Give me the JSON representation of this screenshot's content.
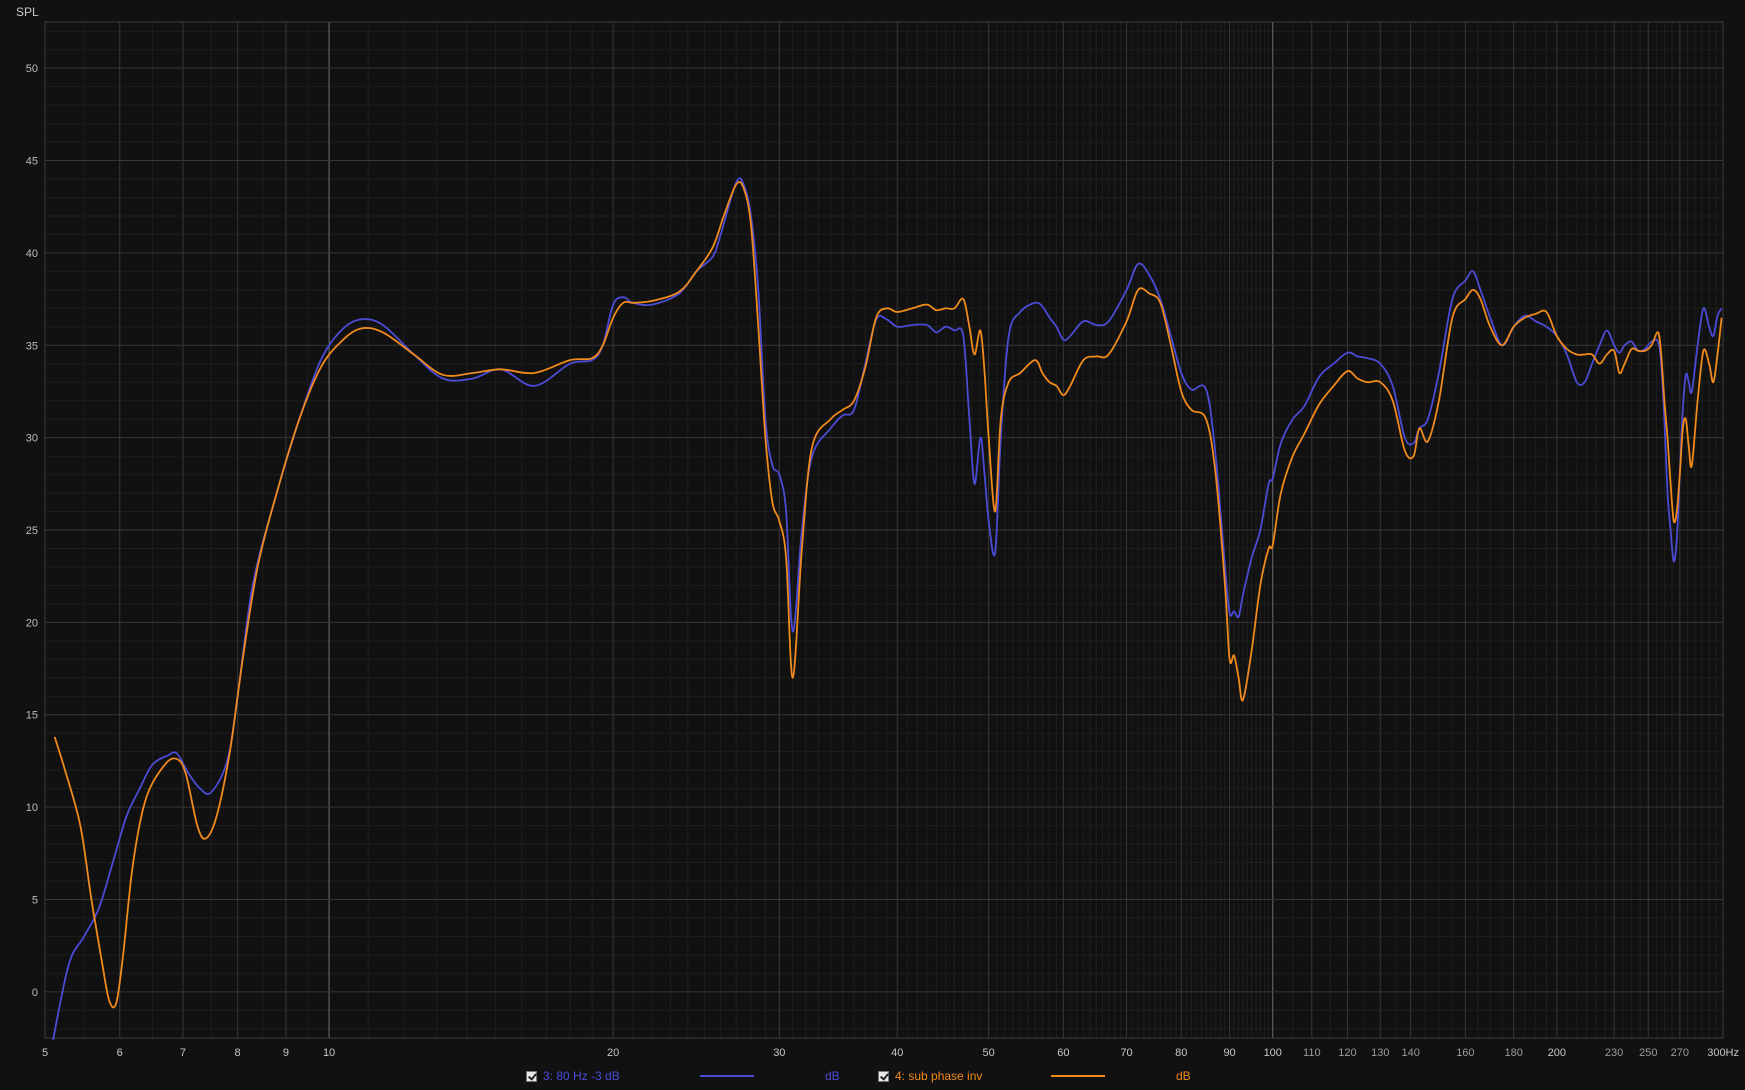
{
  "chart_data": {
    "type": "line",
    "ylabel": "SPL",
    "x_scale": "log",
    "xlim": [
      5,
      300
    ],
    "ylim": [
      -2.5,
      52.5
    ],
    "grid": true,
    "x_ticks": [
      5,
      6,
      7,
      8,
      9,
      10,
      20,
      30,
      40,
      50,
      60,
      70,
      80,
      90,
      100,
      110,
      120,
      130,
      140,
      160,
      180,
      200,
      230,
      250,
      270,
      300
    ],
    "x_tick_labels": [
      "5",
      "6",
      "7",
      "8",
      "9",
      "10",
      "20",
      "30",
      "40",
      "50",
      "60",
      "70",
      "80",
      "90",
      "100",
      "110",
      "120",
      "130",
      "140",
      "160",
      "180",
      "200",
      "230",
      "250",
      "270",
      "300Hz"
    ],
    "y_ticks": [
      0,
      5,
      10,
      15,
      20,
      25,
      30,
      35,
      40,
      45,
      50
    ],
    "y_tick_labels": [
      "0",
      "5",
      "10",
      "15",
      "20",
      "25",
      "30",
      "35",
      "40",
      "45",
      "50"
    ],
    "series": [
      {
        "name": "3: 80 Hz -3 dB",
        "unit": "dB",
        "color": "#4b4bd6",
        "points": [
          [
            5.1,
            -2.6
          ],
          [
            5.3,
            1.5
          ],
          [
            5.5,
            3
          ],
          [
            5.7,
            4.5
          ],
          [
            5.9,
            7
          ],
          [
            6.1,
            9.5
          ],
          [
            6.3,
            11
          ],
          [
            6.5,
            12.3
          ],
          [
            6.75,
            12.8
          ],
          [
            6.9,
            12.9
          ],
          [
            7.1,
            11.8
          ],
          [
            7.3,
            11
          ],
          [
            7.5,
            10.8
          ],
          [
            7.8,
            12.5
          ],
          [
            8.0,
            16
          ],
          [
            8.3,
            22
          ],
          [
            8.8,
            27
          ],
          [
            9.3,
            31
          ],
          [
            9.8,
            34.2
          ],
          [
            10.3,
            35.8
          ],
          [
            10.8,
            36.4
          ],
          [
            11.4,
            36.1
          ],
          [
            12.3,
            34.5
          ],
          [
            13.2,
            33.2
          ],
          [
            14.2,
            33.2
          ],
          [
            15.2,
            33.7
          ],
          [
            16.5,
            32.8
          ],
          [
            18,
            34
          ],
          [
            19,
            34.2
          ],
          [
            19.5,
            35
          ],
          [
            20,
            37.2
          ],
          [
            20.5,
            37.6
          ],
          [
            21,
            37.3
          ],
          [
            22,
            37.2
          ],
          [
            23.5,
            37.8
          ],
          [
            24.5,
            39
          ],
          [
            25.5,
            39.8
          ],
          [
            26,
            41
          ],
          [
            27,
            43.8
          ],
          [
            27.5,
            43.7
          ],
          [
            28,
            42
          ],
          [
            28.5,
            38
          ],
          [
            29,
            31
          ],
          [
            29.5,
            28.5
          ],
          [
            30,
            28
          ],
          [
            30.5,
            26
          ],
          [
            31,
            19.5
          ],
          [
            31.7,
            25
          ],
          [
            32.5,
            29
          ],
          [
            34,
            30.5
          ],
          [
            35,
            31.2
          ],
          [
            36,
            31.5
          ],
          [
            37,
            34
          ],
          [
            38,
            36.4
          ],
          [
            39,
            36.4
          ],
          [
            40,
            36
          ],
          [
            41.5,
            36.1
          ],
          [
            43,
            36.1
          ],
          [
            44,
            35.7
          ],
          [
            45,
            36
          ],
          [
            46,
            35.8
          ],
          [
            47,
            35.5
          ],
          [
            47.7,
            31
          ],
          [
            48.3,
            27.5
          ],
          [
            49,
            30
          ],
          [
            49.5,
            28
          ],
          [
            50,
            25.5
          ],
          [
            50.8,
            23.8
          ],
          [
            51.5,
            30
          ],
          [
            52.5,
            35.5
          ],
          [
            54,
            36.8
          ],
          [
            56,
            37.3
          ],
          [
            57,
            37.1
          ],
          [
            58,
            36.5
          ],
          [
            59,
            36
          ],
          [
            60,
            35.3
          ],
          [
            61,
            35.5
          ],
          [
            63,
            36.3
          ],
          [
            65,
            36.1
          ],
          [
            67,
            36.3
          ],
          [
            70,
            38
          ],
          [
            72,
            39.4
          ],
          [
            74,
            38.8
          ],
          [
            76,
            37.5
          ],
          [
            78,
            35.5
          ],
          [
            80,
            33.5
          ],
          [
            82,
            32.6
          ],
          [
            85,
            32.6
          ],
          [
            87,
            29
          ],
          [
            89,
            23
          ],
          [
            90,
            20.5
          ],
          [
            91,
            20.6
          ],
          [
            92,
            20.3
          ],
          [
            93,
            21.5
          ],
          [
            95,
            23.5
          ],
          [
            97,
            25
          ],
          [
            99,
            27.5
          ],
          [
            100,
            27.8
          ],
          [
            102,
            29.7
          ],
          [
            105,
            31
          ],
          [
            108,
            31.7
          ],
          [
            112,
            33.3
          ],
          [
            116,
            34
          ],
          [
            120,
            34.6
          ],
          [
            123,
            34.4
          ],
          [
            126,
            34.3
          ],
          [
            130,
            34
          ],
          [
            134,
            32.8
          ],
          [
            138,
            30
          ],
          [
            141,
            29.7
          ],
          [
            143,
            30.5
          ],
          [
            146,
            31
          ],
          [
            150,
            33.5
          ],
          [
            155,
            37.5
          ],
          [
            160,
            38.5
          ],
          [
            163,
            39
          ],
          [
            166,
            38
          ],
          [
            170,
            36.5
          ],
          [
            175,
            35
          ],
          [
            180,
            36
          ],
          [
            185,
            36.6
          ],
          [
            190,
            36.3
          ],
          [
            195,
            36
          ],
          [
            200,
            35.5
          ],
          [
            205,
            34.5
          ],
          [
            210,
            33
          ],
          [
            214,
            33
          ],
          [
            218,
            34
          ],
          [
            222,
            35
          ],
          [
            226,
            35.8
          ],
          [
            230,
            35
          ],
          [
            233,
            34.6
          ],
          [
            236,
            35
          ],
          [
            240,
            35.2
          ],
          [
            244,
            34.7
          ],
          [
            248,
            34.8
          ],
          [
            252,
            35.2
          ],
          [
            256,
            35.2
          ],
          [
            258,
            34
          ],
          [
            260,
            31
          ],
          [
            262,
            27
          ],
          [
            264,
            25
          ],
          [
            266,
            23.3
          ],
          [
            268,
            24.5
          ],
          [
            270,
            28
          ],
          [
            272,
            31.5
          ],
          [
            274,
            33.4
          ],
          [
            276,
            33
          ],
          [
            278,
            32.5
          ],
          [
            282,
            35
          ],
          [
            286,
            37
          ],
          [
            290,
            36
          ],
          [
            293,
            35.5
          ],
          [
            296,
            36.6
          ],
          [
            299,
            37
          ]
        ]
      },
      {
        "name": "4: sub phase inv",
        "unit": "dB",
        "color": "#f08a1c",
        "points": [
          [
            5.12,
            13.8
          ],
          [
            5.25,
            12
          ],
          [
            5.45,
            9
          ],
          [
            5.6,
            5
          ],
          [
            5.75,
            1.5
          ],
          [
            5.85,
            -0.5
          ],
          [
            5.95,
            -0.6
          ],
          [
            6.05,
            2
          ],
          [
            6.2,
            7
          ],
          [
            6.4,
            10.5
          ],
          [
            6.7,
            12.3
          ],
          [
            6.9,
            12.6
          ],
          [
            7.05,
            11.8
          ],
          [
            7.25,
            9
          ],
          [
            7.4,
            8.3
          ],
          [
            7.6,
            9.5
          ],
          [
            7.85,
            13
          ],
          [
            8.1,
            18
          ],
          [
            8.4,
            23
          ],
          [
            8.8,
            27
          ],
          [
            9.3,
            31
          ],
          [
            9.8,
            33.8
          ],
          [
            10.3,
            35.2
          ],
          [
            10.8,
            35.9
          ],
          [
            11.4,
            35.7
          ],
          [
            12.3,
            34.5
          ],
          [
            13.2,
            33.4
          ],
          [
            14.2,
            33.5
          ],
          [
            15.2,
            33.7
          ],
          [
            16.5,
            33.5
          ],
          [
            18,
            34.2
          ],
          [
            19,
            34.3
          ],
          [
            19.5,
            35
          ],
          [
            20,
            36.5
          ],
          [
            20.5,
            37.3
          ],
          [
            21,
            37.3
          ],
          [
            22,
            37.4
          ],
          [
            23.5,
            37.9
          ],
          [
            24.5,
            39
          ],
          [
            25.5,
            40.3
          ],
          [
            26.2,
            42
          ],
          [
            27,
            43.7
          ],
          [
            27.5,
            43.5
          ],
          [
            28,
            41.5
          ],
          [
            28.5,
            36
          ],
          [
            29,
            30
          ],
          [
            29.5,
            26.5
          ],
          [
            30,
            25.5
          ],
          [
            30.5,
            23.5
          ],
          [
            31,
            17
          ],
          [
            31.7,
            24
          ],
          [
            32.5,
            29.5
          ],
          [
            34,
            31
          ],
          [
            35,
            31.5
          ],
          [
            36,
            32
          ],
          [
            37,
            33.8
          ],
          [
            38,
            36.5
          ],
          [
            39,
            37
          ],
          [
            40,
            36.8
          ],
          [
            41.5,
            37
          ],
          [
            43,
            37.2
          ],
          [
            44,
            36.9
          ],
          [
            45,
            37
          ],
          [
            46,
            37
          ],
          [
            47,
            37.5
          ],
          [
            47.7,
            36
          ],
          [
            48.3,
            34.5
          ],
          [
            49,
            35.8
          ],
          [
            49.5,
            33.5
          ],
          [
            50,
            30
          ],
          [
            50.8,
            26
          ],
          [
            51.5,
            31
          ],
          [
            52.5,
            33
          ],
          [
            54,
            33.5
          ],
          [
            56,
            34.2
          ],
          [
            57,
            33.5
          ],
          [
            58,
            33
          ],
          [
            59,
            32.8
          ],
          [
            60,
            32.3
          ],
          [
            61,
            32.8
          ],
          [
            63,
            34.2
          ],
          [
            65,
            34.4
          ],
          [
            67,
            34.5
          ],
          [
            70,
            36.3
          ],
          [
            72,
            38
          ],
          [
            74,
            37.8
          ],
          [
            76,
            37.3
          ],
          [
            78,
            35
          ],
          [
            80,
            32.5
          ],
          [
            82,
            31.5
          ],
          [
            85,
            31
          ],
          [
            87,
            28
          ],
          [
            89,
            22
          ],
          [
            90,
            18
          ],
          [
            91,
            18.2
          ],
          [
            92,
            17
          ],
          [
            93,
            15.8
          ],
          [
            95,
            18.5
          ],
          [
            97,
            22
          ],
          [
            99,
            24
          ],
          [
            100,
            24.2
          ],
          [
            102,
            27
          ],
          [
            105,
            29
          ],
          [
            108,
            30.2
          ],
          [
            112,
            31.8
          ],
          [
            116,
            32.8
          ],
          [
            120,
            33.6
          ],
          [
            123,
            33.2
          ],
          [
            126,
            33
          ],
          [
            130,
            33
          ],
          [
            134,
            32
          ],
          [
            138,
            29.3
          ],
          [
            141,
            29
          ],
          [
            143,
            30.5
          ],
          [
            146,
            29.8
          ],
          [
            150,
            32
          ],
          [
            155,
            36.5
          ],
          [
            160,
            37.5
          ],
          [
            163,
            38
          ],
          [
            166,
            37.5
          ],
          [
            170,
            36
          ],
          [
            175,
            35
          ],
          [
            180,
            36
          ],
          [
            185,
            36.5
          ],
          [
            190,
            36.7
          ],
          [
            195,
            36.8
          ],
          [
            200,
            35.5
          ],
          [
            205,
            34.8
          ],
          [
            210,
            34.5
          ],
          [
            214,
            34.5
          ],
          [
            218,
            34.5
          ],
          [
            222,
            34
          ],
          [
            226,
            34.5
          ],
          [
            230,
            34.7
          ],
          [
            233,
            33.5
          ],
          [
            236,
            34
          ],
          [
            240,
            34.8
          ],
          [
            244,
            34.7
          ],
          [
            248,
            34.7
          ],
          [
            252,
            35
          ],
          [
            256,
            35.7
          ],
          [
            258,
            34.5
          ],
          [
            260,
            32
          ],
          [
            262,
            30
          ],
          [
            264,
            27.5
          ],
          [
            266,
            25.5
          ],
          [
            268,
            26
          ],
          [
            270,
            28
          ],
          [
            272,
            30.5
          ],
          [
            274,
            31
          ],
          [
            276,
            29.5
          ],
          [
            278,
            28.5
          ],
          [
            282,
            32
          ],
          [
            286,
            34.7
          ],
          [
            290,
            34
          ],
          [
            293,
            33
          ],
          [
            296,
            34.5
          ],
          [
            299,
            36.5
          ]
        ]
      }
    ]
  },
  "legend": {
    "s3": {
      "label": "3: 80 Hz -3 dB",
      "unit": "dB",
      "color": "#4b4bd6"
    },
    "s4": {
      "label": "4: sub phase inv",
      "unit": "dB",
      "color": "#f08a1c"
    }
  }
}
